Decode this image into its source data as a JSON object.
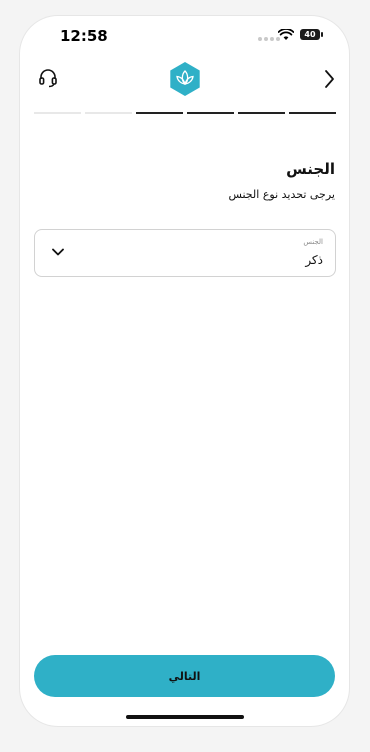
{
  "status_bar": {
    "time": "12:58",
    "battery_level": "40"
  },
  "header": {
    "support_icon": "headset-icon",
    "logo_icon": "lotus-logo-icon",
    "back_icon": "chevron-right-icon",
    "brand_color": "#2fb0c7"
  },
  "progress": {
    "total_steps": 6,
    "completed_steps": 4
  },
  "main": {
    "title": "الجنس",
    "subtitle": "يرجى تحديد نوع الجنس",
    "gender_select": {
      "label": "الجنس",
      "value": "ذكر"
    }
  },
  "footer": {
    "next_label": "التالي"
  }
}
